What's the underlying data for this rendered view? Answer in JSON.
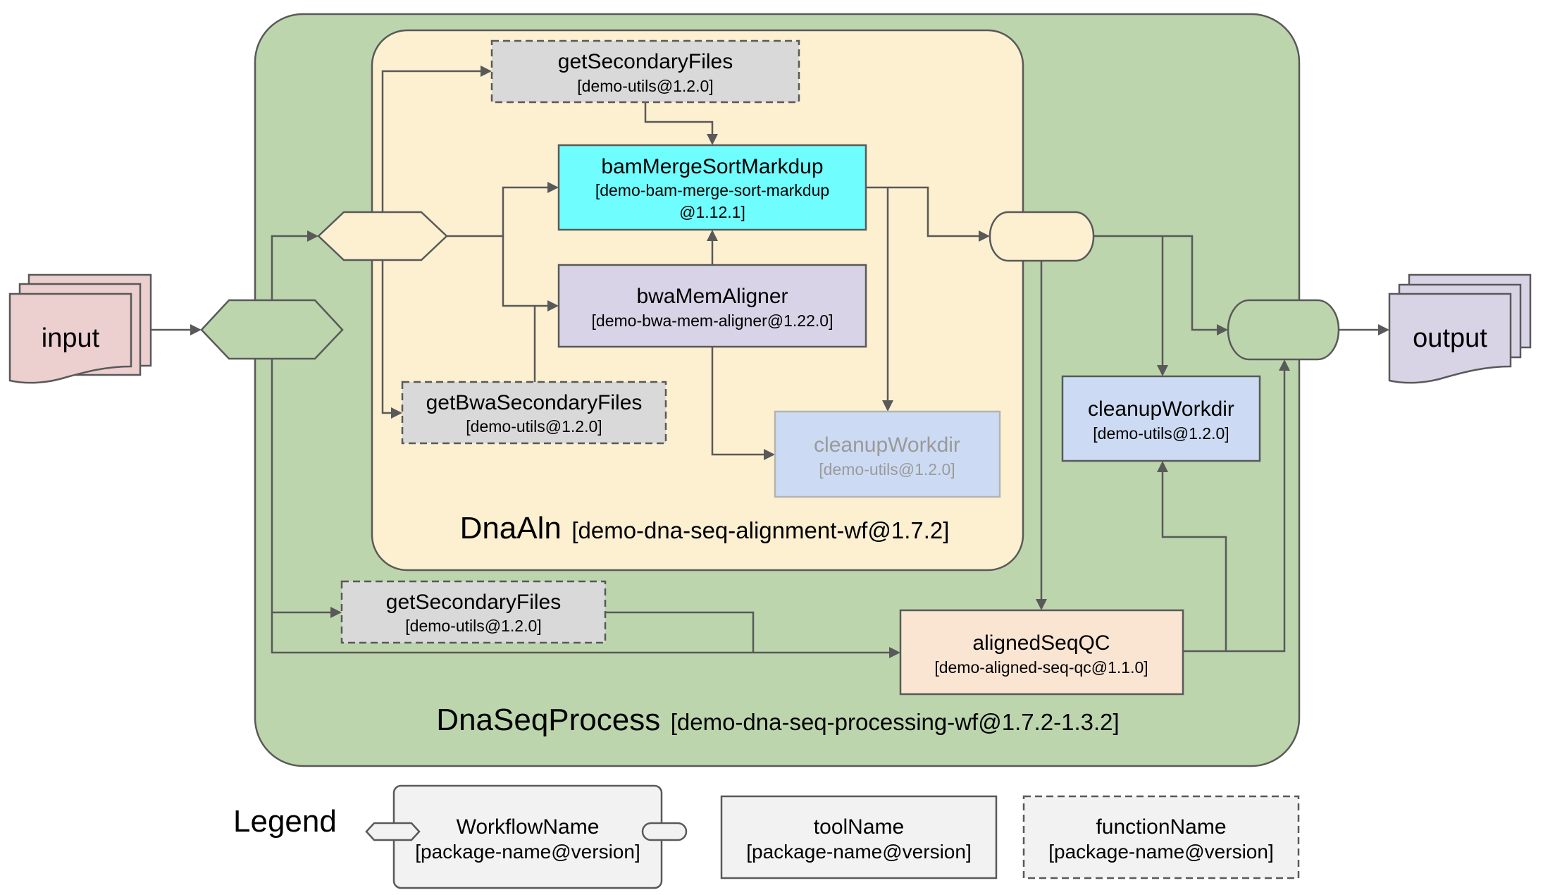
{
  "diagram": {
    "input": {
      "label": "input",
      "color": "#eccfcf"
    },
    "output": {
      "label": "output",
      "color": "#d9d3e6"
    },
    "workflows": {
      "outer": {
        "name": "DnaSeqProcess",
        "package": "[demo-dna-seq-processing-wf@1.7.2-1.3.2]",
        "color": "#bcd5ad"
      },
      "inner": {
        "name": "DnaAln",
        "package": "[demo-dna-seq-alignment-wf@1.7.2]",
        "color": "#fdf0d1"
      }
    },
    "nodes": {
      "getSecondaryFilesInner": {
        "name": "getSecondaryFiles",
        "package": "[demo-utils@1.2.0]",
        "kind": "function"
      },
      "bamMergeSortMarkdup": {
        "name": "bamMergeSortMarkdup",
        "package_line1": "[demo-bam-merge-sort-markdup",
        "package_line2": "@1.12.1]",
        "kind": "tool",
        "color": "#6ffdfd"
      },
      "bwaMemAligner": {
        "name": "bwaMemAligner",
        "package": "[demo-bwa-mem-aligner@1.22.0]",
        "kind": "tool",
        "color": "#d8d3e6"
      },
      "getBwaSecondaryFiles": {
        "name": "getBwaSecondaryFiles",
        "package": "[demo-utils@1.2.0]",
        "kind": "function"
      },
      "cleanupWorkdirInner": {
        "name": "cleanupWorkdir",
        "package": "[demo-utils@1.2.0]",
        "kind": "tool",
        "state": "disabled",
        "color": "#ccdbf3"
      },
      "getSecondaryFilesOuter": {
        "name": "getSecondaryFiles",
        "package": "[demo-utils@1.2.0]",
        "kind": "function"
      },
      "alignedSeqQC": {
        "name": "alignedSeqQC",
        "package": "[demo-aligned-seq-qc@1.1.0]",
        "kind": "tool",
        "color": "#fae5d3"
      },
      "cleanupWorkdirOuter": {
        "name": "cleanupWorkdir",
        "package": "[demo-utils@1.2.0]",
        "kind": "tool",
        "color": "#ccdbf3"
      }
    },
    "edges": [
      [
        "input",
        "DnaSeqProcess.in"
      ],
      [
        "DnaSeqProcess.in",
        "DnaAln.in"
      ],
      [
        "DnaSeqProcess.in",
        "getSecondaryFilesOuter"
      ],
      [
        "DnaSeqProcess.in",
        "alignedSeqQC"
      ],
      [
        "DnaAln.in",
        "getSecondaryFilesInner"
      ],
      [
        "DnaAln.in",
        "bamMergeSortMarkdup"
      ],
      [
        "DnaAln.in",
        "bwaMemAligner"
      ],
      [
        "DnaAln.in",
        "getBwaSecondaryFiles"
      ],
      [
        "getSecondaryFilesInner",
        "bamMergeSortMarkdup"
      ],
      [
        "getBwaSecondaryFiles",
        "bwaMemAligner"
      ],
      [
        "bwaMemAligner",
        "bamMergeSortMarkdup"
      ],
      [
        "bwaMemAligner",
        "cleanupWorkdirInner"
      ],
      [
        "bamMergeSortMarkdup",
        "cleanupWorkdirInner"
      ],
      [
        "bamMergeSortMarkdup",
        "DnaAln.out"
      ],
      [
        "DnaAln.out",
        "alignedSeqQC"
      ],
      [
        "DnaAln.out",
        "cleanupWorkdirOuter"
      ],
      [
        "DnaAln.out",
        "DnaSeqProcess.out"
      ],
      [
        "getSecondaryFilesOuter",
        "alignedSeqQC"
      ],
      [
        "alignedSeqQC",
        "cleanupWorkdirOuter"
      ],
      [
        "alignedSeqQC",
        "DnaSeqProcess.out"
      ],
      [
        "DnaSeqProcess.out",
        "output"
      ]
    ]
  },
  "legend": {
    "title": "Legend",
    "workflow": {
      "name": "WorkflowName",
      "package": "[package-name@version]"
    },
    "tool": {
      "name": "toolName",
      "package": "[package-name@version]"
    },
    "function": {
      "name": "functionName",
      "package": "[package-name@version]"
    }
  }
}
